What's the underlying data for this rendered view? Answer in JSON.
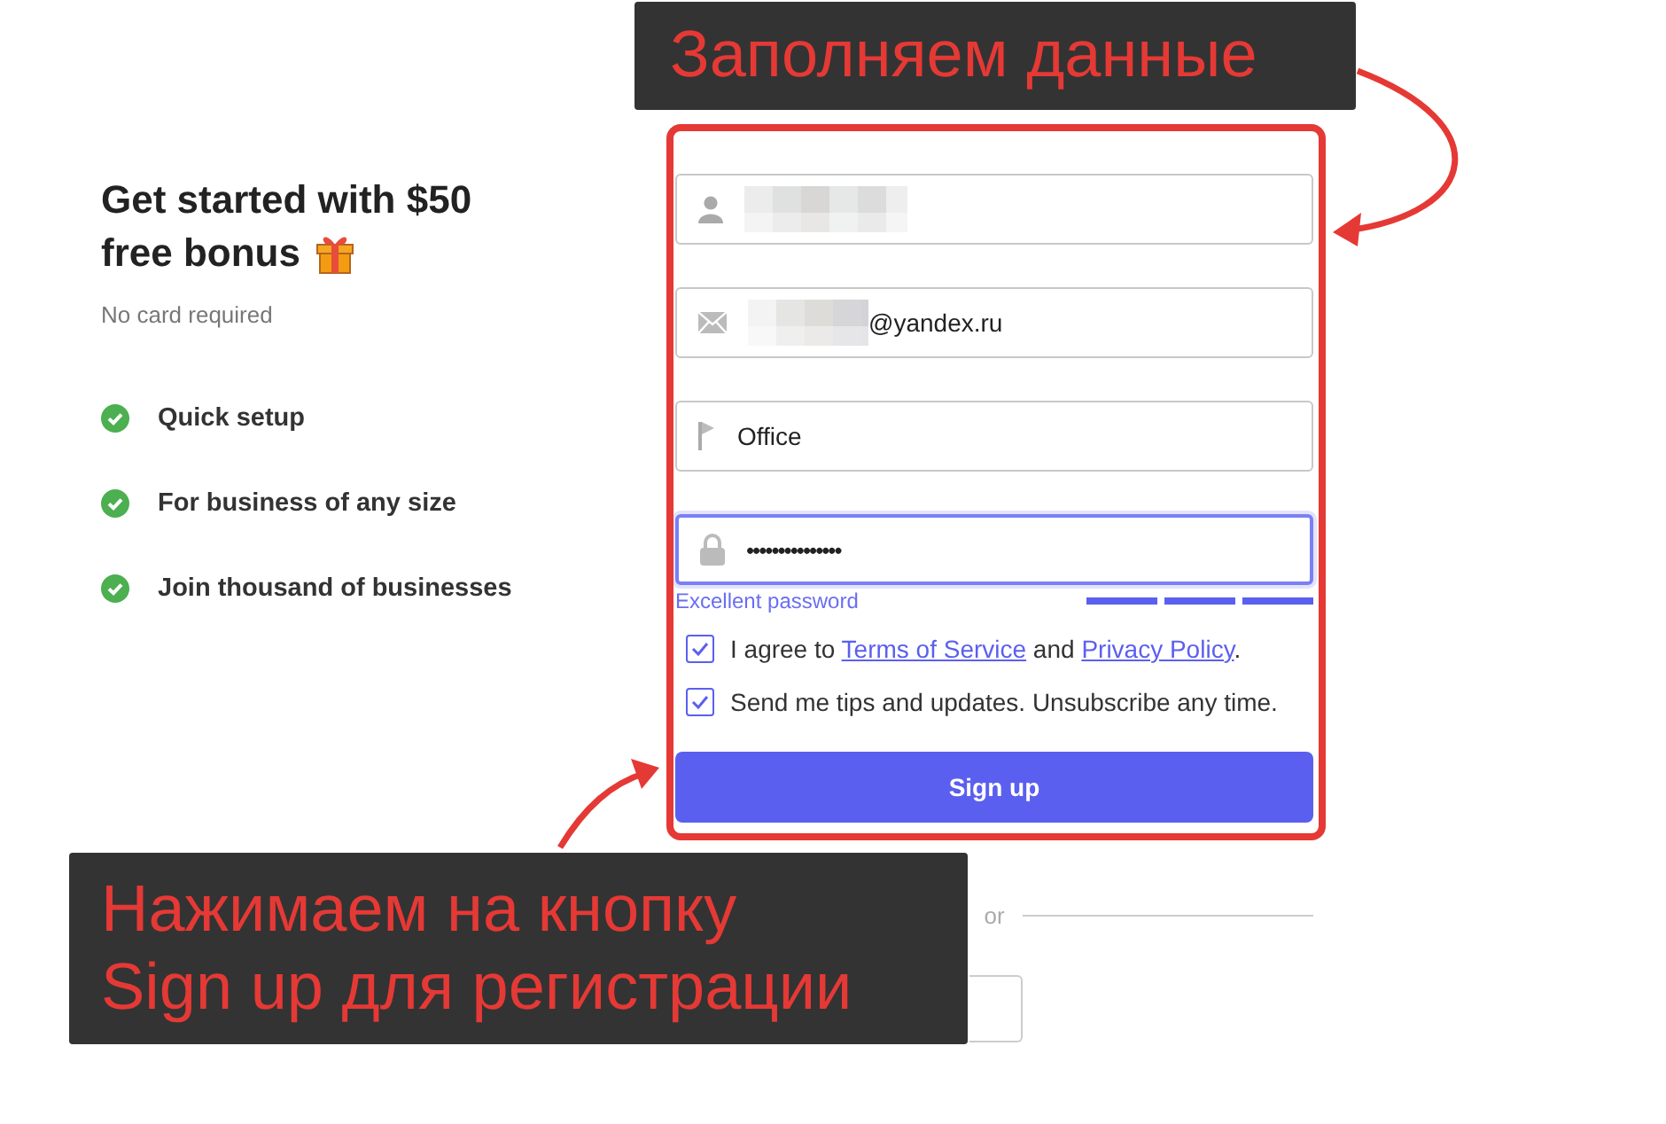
{
  "intro": {
    "title_lines": [
      "Get started with $50",
      "free bonus"
    ],
    "note": "No card required"
  },
  "features": [
    {
      "label": "Quick setup"
    },
    {
      "label": "For business of any size"
    },
    {
      "label": "Join thousand of businesses"
    }
  ],
  "form": {
    "fields": [
      {
        "kind": "name",
        "redacted": true
      },
      {
        "kind": "email",
        "redacted": true,
        "value": "@yandex.ru"
      },
      {
        "kind": "place",
        "redacted": false,
        "value": "Office"
      },
      {
        "kind": "password",
        "redacted": false,
        "value": "•••••••••••••••",
        "focused": true
      }
    ],
    "strength": {
      "label": "Excellent password",
      "level": 1
    },
    "consents": [
      {
        "checked": true,
        "parts": [
          {
            "text": "I agree to "
          },
          {
            "text": "Terms of Service",
            "link": true
          },
          {
            "text": " and "
          },
          {
            "text": "Privacy Policy",
            "link": true
          },
          {
            "text": "."
          }
        ]
      },
      {
        "checked": true,
        "parts": [
          {
            "text": "Send me tips and updates. Unsubscribe any time."
          }
        ]
      }
    ],
    "submit": "Sign up",
    "divider": "or"
  },
  "annotations": [
    {
      "kind": "top",
      "text": "Заполняем данные"
    },
    {
      "kind": "bottom",
      "text": "Нажимаем на кнопку\nSign up для регистрации"
    }
  ]
}
